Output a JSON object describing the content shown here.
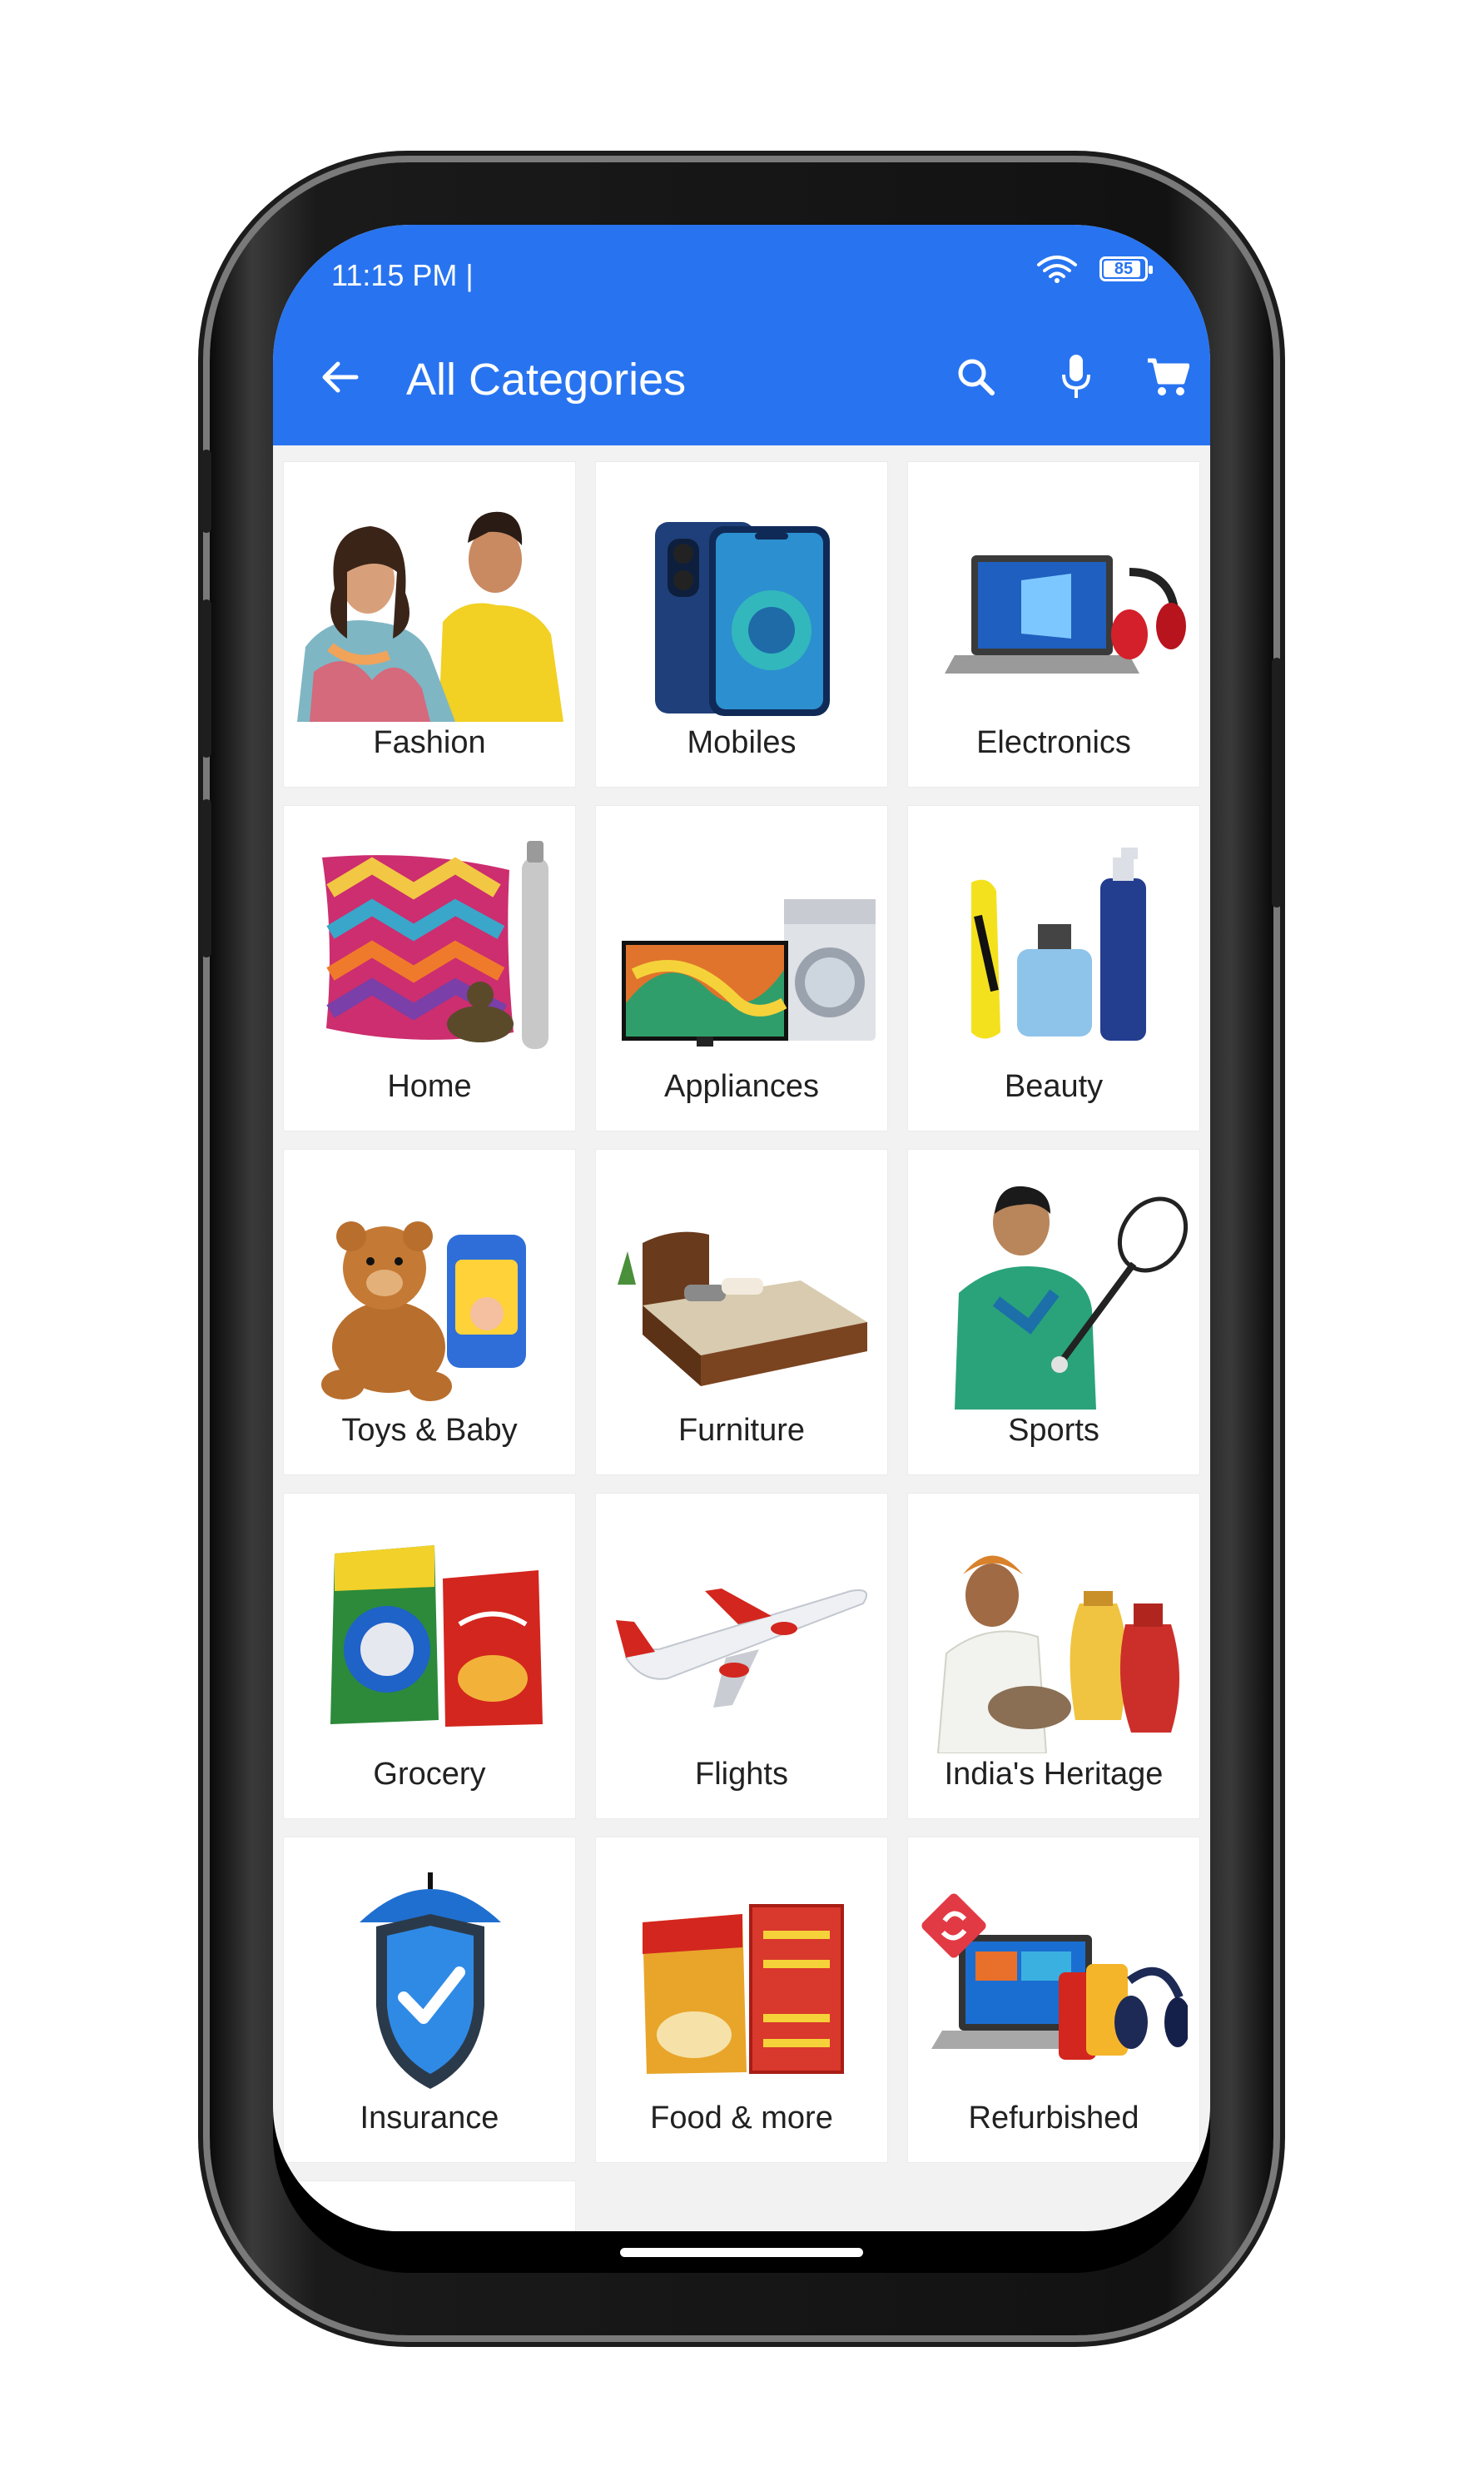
{
  "status_bar": {
    "time": "11:15 PM |",
    "battery": "85"
  },
  "toolbar": {
    "title": "All Categories"
  },
  "categories": [
    {
      "label": "Fashion",
      "icon": "fashion-icon"
    },
    {
      "label": "Mobiles",
      "icon": "mobiles-icon"
    },
    {
      "label": "Electronics",
      "icon": "electronics-icon"
    },
    {
      "label": "Home",
      "icon": "home-icon"
    },
    {
      "label": "Appliances",
      "icon": "appliances-icon"
    },
    {
      "label": "Beauty",
      "icon": "beauty-icon"
    },
    {
      "label": "Toys & Baby",
      "icon": "toys-baby-icon"
    },
    {
      "label": "Furniture",
      "icon": "furniture-icon"
    },
    {
      "label": "Sports",
      "icon": "sports-icon"
    },
    {
      "label": "Grocery",
      "icon": "grocery-icon"
    },
    {
      "label": "Flights",
      "icon": "flights-icon"
    },
    {
      "label": "India's Heritage",
      "icon": "indias-heritage-icon"
    },
    {
      "label": "Insurance",
      "icon": "insurance-icon"
    },
    {
      "label": "Food & more",
      "icon": "food-more-icon"
    },
    {
      "label": "Refurbished",
      "icon": "refurbished-icon"
    }
  ],
  "colors": {
    "brand": "#2874f0",
    "background": "#f2f2f2",
    "card": "#ffffff",
    "text": "#212121"
  }
}
